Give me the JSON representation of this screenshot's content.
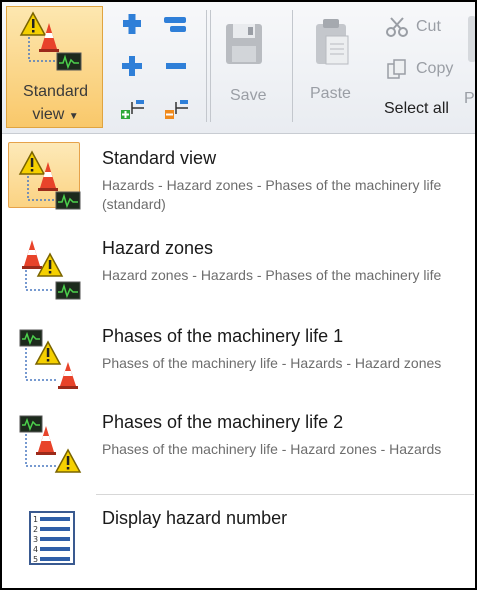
{
  "ribbon": {
    "view_button": {
      "label_line1": "Standard",
      "label_line2": "view",
      "icon": "standard-view-icon"
    },
    "add_icon": "plus-icon",
    "remove_icon": "minus-icon",
    "save_label": "Save",
    "paste_label": "Paste",
    "cut_label": "Cut",
    "copy_label": "Copy",
    "select_all_label": "Select all",
    "clipped_label": "P"
  },
  "menu": {
    "items": [
      {
        "title": "Standard view",
        "description": "Hazards - Hazard zones - Phases of the machinery life (standard)",
        "icon": "warning-cone-monitor-icon",
        "selected": true
      },
      {
        "title": "Hazard zones",
        "description": "Hazard zones - Hazards - Phases of the machinery life",
        "icon": "cone-warning-monitor-icon",
        "selected": false
      },
      {
        "title": "Phases of the machinery life 1",
        "description": "Phases of the machinery life - Hazards - Hazard zones",
        "icon": "monitor-warning-cone-icon",
        "selected": false
      },
      {
        "title": "Phases of the machinery life 2",
        "description": "Phases of the machinery life - Hazard zones - Hazards",
        "icon": "monitor-cone-warning-icon",
        "selected": false
      },
      {
        "title": "Display hazard number",
        "description": "",
        "icon": "numbered-list-icon",
        "selected": false
      }
    ]
  },
  "colors": {
    "accent": "#f9c86a",
    "accent_border": "#e0a440",
    "warning": "#f5d000",
    "cone": "#e03a1e",
    "monitor": "#2b6b2f"
  }
}
